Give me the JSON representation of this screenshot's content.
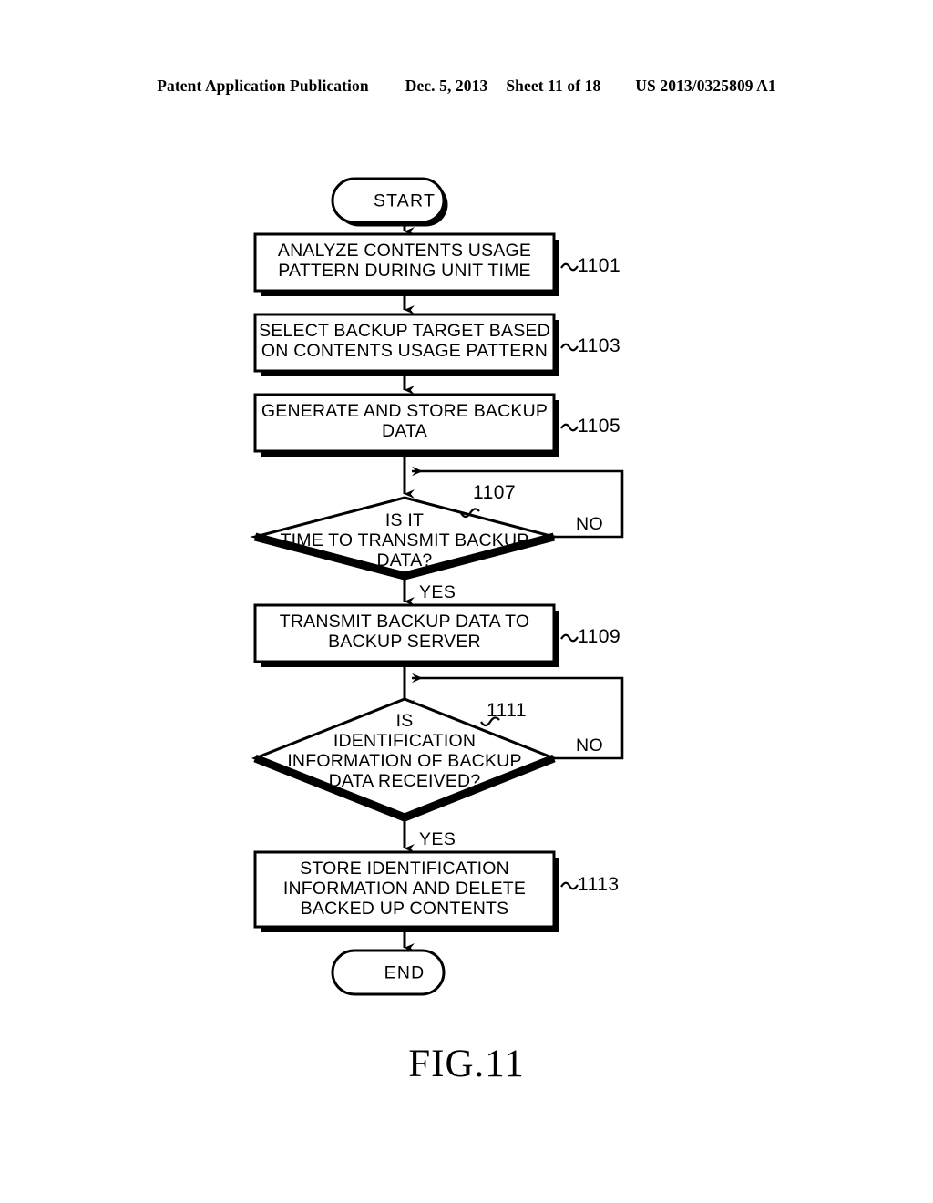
{
  "header": {
    "publication": "Patent Application Publication",
    "date": "Dec. 5, 2013",
    "sheet": "Sheet 11 of 18",
    "patent_number": "US 2013/0325809 A1"
  },
  "figure": {
    "caption": "FIG.11",
    "type": "flowchart"
  },
  "flowchart": {
    "start_label": "START",
    "end_label": "END",
    "nodes": [
      {
        "id": "start",
        "shape": "terminator",
        "lines": [
          "START"
        ],
        "ref": ""
      },
      {
        "id": "n1101",
        "shape": "process",
        "lines": [
          "ANALYZE CONTENTS USAGE",
          "PATTERN DURING UNIT TIME"
        ],
        "ref": "1101"
      },
      {
        "id": "n1103",
        "shape": "process",
        "lines": [
          "SELECT BACKUP TARGET BASED",
          "ON CONTENTS USAGE PATTERN"
        ],
        "ref": "1103"
      },
      {
        "id": "n1105",
        "shape": "process",
        "lines": [
          "GENERATE AND STORE BACKUP",
          "DATA"
        ],
        "ref": "1105"
      },
      {
        "id": "n1107",
        "shape": "decision",
        "lines": [
          "IS IT",
          "TIME TO TRANSMIT BACKUP",
          "DATA?"
        ],
        "ref": "1107",
        "yes_label": "YES",
        "no_label": "NO"
      },
      {
        "id": "n1109",
        "shape": "process",
        "lines": [
          "TRANSMIT BACKUP DATA TO",
          "BACKUP SERVER"
        ],
        "ref": "1109"
      },
      {
        "id": "n1111",
        "shape": "decision",
        "lines": [
          "IS",
          "IDENTIFICATION",
          "INFORMATION OF BACKUP",
          "DATA RECEIVED?"
        ],
        "ref": "1111",
        "yes_label": "YES",
        "no_label": "NO"
      },
      {
        "id": "n1113",
        "shape": "process",
        "lines": [
          "STORE IDENTIFICATION",
          "INFORMATION AND DELETE",
          "BACKED UP CONTENTS"
        ],
        "ref": "1113"
      },
      {
        "id": "end",
        "shape": "terminator",
        "lines": [
          "END"
        ],
        "ref": ""
      }
    ],
    "colors": {
      "ink": "#000000",
      "paper": "#ffffff"
    }
  }
}
